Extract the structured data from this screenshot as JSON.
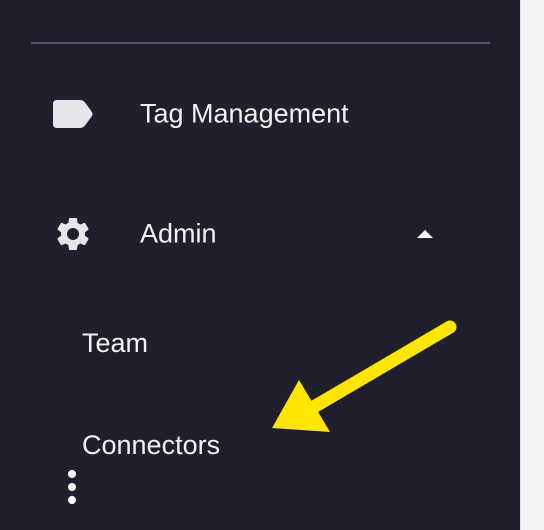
{
  "sidebar": {
    "items": [
      {
        "label": "Tag Management",
        "icon": "tag-icon"
      },
      {
        "label": "Admin",
        "icon": "gear-icon",
        "expanded": true
      }
    ],
    "admin_subitems": [
      {
        "label": "Team"
      },
      {
        "label": "Connectors"
      }
    ]
  },
  "colors": {
    "sidebar_background": "#1f1f2e",
    "text": "#f2f2f5",
    "icon": "#e6e6ea",
    "annotation_arrow": "#ffe600"
  }
}
